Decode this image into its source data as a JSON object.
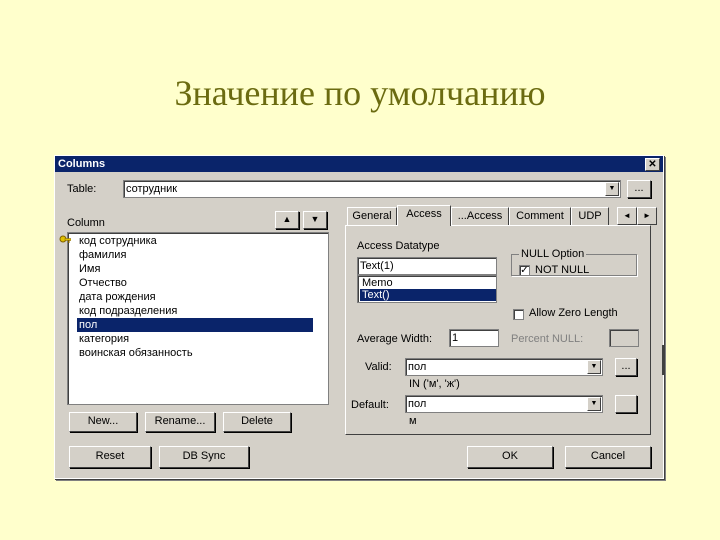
{
  "slide": {
    "title": "Значение по умолчанию"
  },
  "dialog": {
    "title": "Columns",
    "close_glyph": "✕",
    "table_label": "Table:",
    "table_value": "сотрудник",
    "ellipsis": "...",
    "column_label": "Column",
    "up_glyph": "▲",
    "down_glyph": "▼",
    "columns": [
      "код сотрудника",
      "фамилия",
      "Имя",
      "Отчество",
      "дата рождения",
      "код подразделения",
      "пол",
      "категория",
      "воинская обязанность"
    ],
    "selected_column": "пол",
    "buttons": {
      "new": "New...",
      "rename": "Rename...",
      "delete": "Delete",
      "reset": "Reset",
      "db_sync": "DB Sync",
      "ok": "OK",
      "cancel": "Cancel"
    },
    "tabs": [
      "General",
      "Access",
      "...Access",
      "Comment",
      "UDP"
    ],
    "active_tab": "Access",
    "tab_scroll": {
      "left": "◄",
      "right": "►"
    },
    "access": {
      "datatype_label": "Access Datatype",
      "datatype_value": "Text(1)",
      "datatype_options": [
        "Memo",
        "Text()"
      ],
      "datatype_selected_option": "Text()",
      "null_group_label": "NULL Option",
      "not_null_label": "NOT NULL",
      "not_null_checked": true,
      "allow_zero_label": "Allow Zero Length",
      "allow_zero_checked": false,
      "avg_width_label": "Average Width:",
      "avg_width_value": "1",
      "percent_null_label": "Percent NULL:",
      "valid_label": "Valid:",
      "valid_value": "пол",
      "valid_expr": "IN ('м', 'ж')",
      "default_label": "Default:",
      "default_value": "пол",
      "default_expr": "м"
    },
    "icons": {
      "key": "key-icon"
    },
    "colors": {
      "title_bar": "#0a246a",
      "dialog_face": "#d4d0c8",
      "slide_bg": "#ffffcc",
      "slide_title": "#6b6b10"
    }
  }
}
